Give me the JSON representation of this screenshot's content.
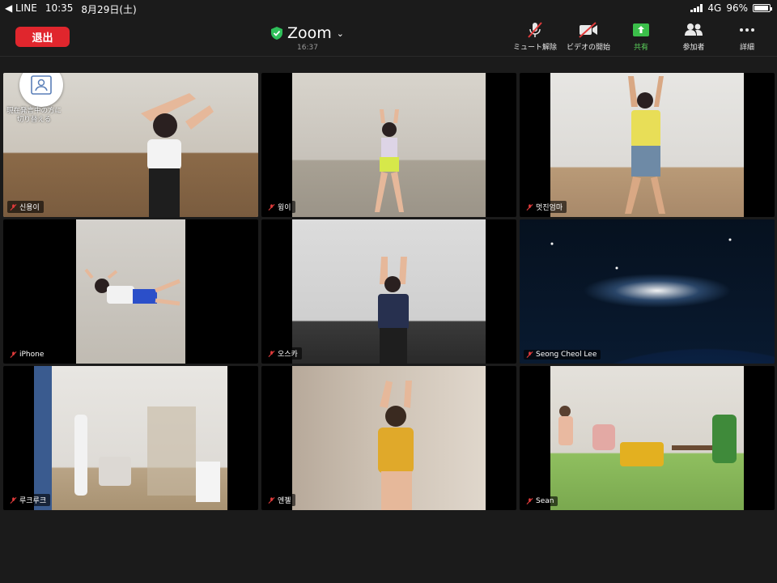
{
  "status_bar": {
    "back_app": "◀ LINE",
    "time": "10:35",
    "date": "8月29日(土)",
    "network": "4G",
    "battery": "96%",
    "battery_level": 0.96
  },
  "toolbar": {
    "leave_label": "退出",
    "app_title": "Zoom",
    "meeting_clock": "16:37",
    "tools": [
      {
        "label": "ミュート解除",
        "icon": "mic-off-icon"
      },
      {
        "label": "ビデオの開始",
        "icon": "video-off-icon"
      },
      {
        "label": "共有",
        "icon": "share-icon"
      },
      {
        "label": "参加者",
        "icon": "participants-icon"
      },
      {
        "label": "詳細",
        "icon": "more-icon"
      }
    ]
  },
  "switch_speaker": {
    "label": "現在発言中の方に切り替える"
  },
  "participants": [
    {
      "name": "신용이",
      "muted": true
    },
    {
      "name": "윙이",
      "muted": true
    },
    {
      "name": "멋진엄마",
      "muted": true
    },
    {
      "name": "iPhone",
      "muted": true
    },
    {
      "name": "오스카",
      "muted": true
    },
    {
      "name": "Seong Cheol Lee",
      "muted": true
    },
    {
      "name": "루크루크",
      "muted": true
    },
    {
      "name": "엔젤",
      "muted": true
    },
    {
      "name": "Sean",
      "muted": true
    }
  ],
  "colors": {
    "leave_red": "#e0262d",
    "share_green": "#5cd35c",
    "shield_green": "#2fbf5a",
    "mute_red": "#e23b3b"
  }
}
